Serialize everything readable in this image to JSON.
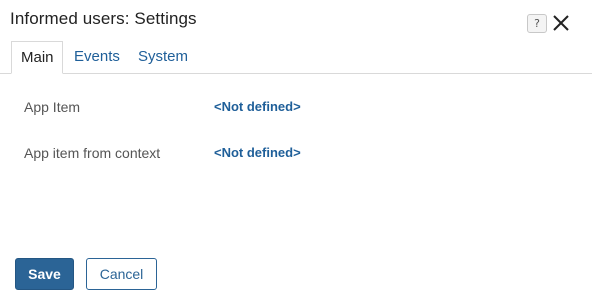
{
  "dialog": {
    "title": "Informed users: Settings",
    "help_label": "?"
  },
  "tabs": [
    {
      "label": "Main",
      "active": true
    },
    {
      "label": "Events",
      "active": false
    },
    {
      "label": "System",
      "active": false
    }
  ],
  "fields": [
    {
      "label": "App Item",
      "value": "<Not defined>"
    },
    {
      "label": "App item from context",
      "value": "<Not defined>"
    }
  ],
  "footer": {
    "save_label": "Save",
    "cancel_label": "Cancel"
  },
  "colors": {
    "accent": "#2b6496",
    "link": "#1f5f99"
  }
}
